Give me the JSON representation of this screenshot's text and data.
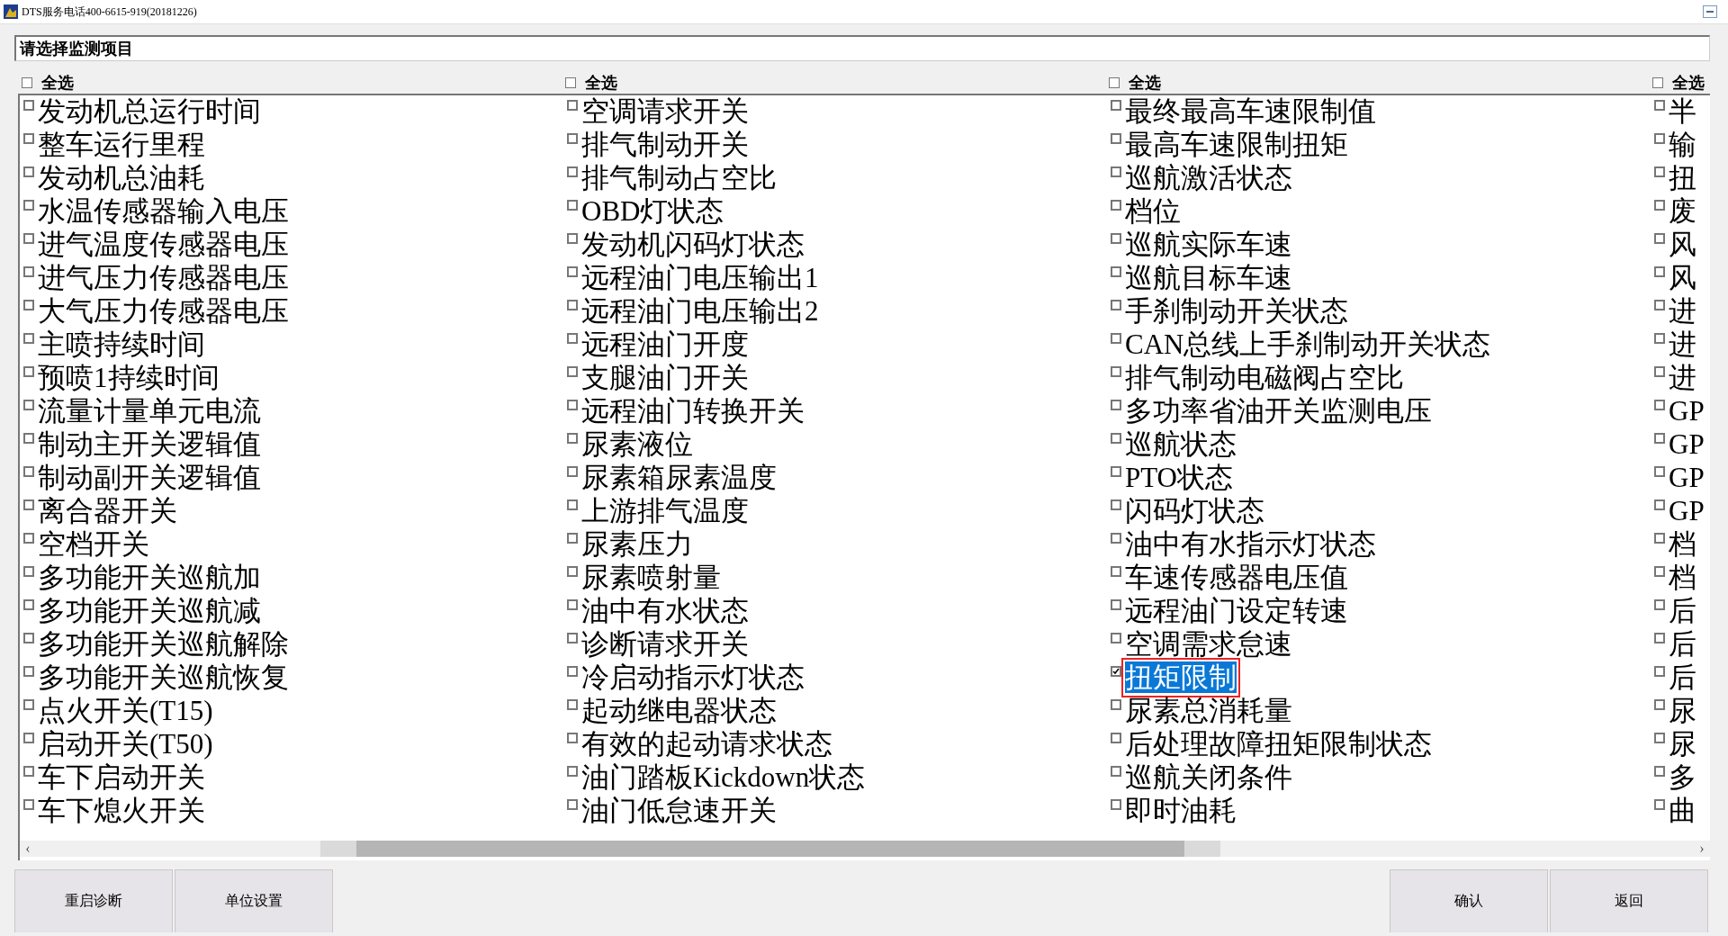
{
  "window": {
    "title": "DTS服务电话400-6615-919(20181226)"
  },
  "prompt": "请选择监测项目",
  "columns": [
    {
      "select_all": {
        "label": "全选",
        "checked": false
      },
      "items": [
        {
          "label": "发动机总运行时间",
          "checked": false,
          "selected": false
        },
        {
          "label": "整车运行里程",
          "checked": false,
          "selected": false
        },
        {
          "label": "发动机总油耗",
          "checked": false,
          "selected": false
        },
        {
          "label": "水温传感器输入电压",
          "checked": false,
          "selected": false
        },
        {
          "label": "进气温度传感器电压",
          "checked": false,
          "selected": false
        },
        {
          "label": "进气压力传感器电压",
          "checked": false,
          "selected": false
        },
        {
          "label": "大气压力传感器电压",
          "checked": false,
          "selected": false
        },
        {
          "label": "主喷持续时间",
          "checked": false,
          "selected": false
        },
        {
          "label": "预喷1持续时间",
          "checked": false,
          "selected": false
        },
        {
          "label": "流量计量单元电流",
          "checked": false,
          "selected": false
        },
        {
          "label": "制动主开关逻辑值",
          "checked": false,
          "selected": false
        },
        {
          "label": "制动副开关逻辑值",
          "checked": false,
          "selected": false
        },
        {
          "label": "离合器开关",
          "checked": false,
          "selected": false
        },
        {
          "label": "空档开关",
          "checked": false,
          "selected": false
        },
        {
          "label": "多功能开关巡航加",
          "checked": false,
          "selected": false
        },
        {
          "label": "多功能开关巡航减",
          "checked": false,
          "selected": false
        },
        {
          "label": "多功能开关巡航解除",
          "checked": false,
          "selected": false
        },
        {
          "label": "多功能开关巡航恢复",
          "checked": false,
          "selected": false
        },
        {
          "label": "点火开关(T15)",
          "checked": false,
          "selected": false
        },
        {
          "label": "启动开关(T50)",
          "checked": false,
          "selected": false
        },
        {
          "label": "车下启动开关",
          "checked": false,
          "selected": false
        },
        {
          "label": "车下熄火开关",
          "checked": false,
          "selected": false
        }
      ]
    },
    {
      "select_all": {
        "label": "全选",
        "checked": false
      },
      "items": [
        {
          "label": "空调请求开关",
          "checked": false,
          "selected": false
        },
        {
          "label": "排气制动开关",
          "checked": false,
          "selected": false
        },
        {
          "label": "排气制动占空比",
          "checked": false,
          "selected": false
        },
        {
          "label": "OBD灯状态",
          "checked": false,
          "selected": false
        },
        {
          "label": "发动机闪码灯状态",
          "checked": false,
          "selected": false
        },
        {
          "label": "远程油门电压输出1",
          "checked": false,
          "selected": false
        },
        {
          "label": "远程油门电压输出2",
          "checked": false,
          "selected": false
        },
        {
          "label": "远程油门开度",
          "checked": false,
          "selected": false
        },
        {
          "label": "支腿油门开关",
          "checked": false,
          "selected": false
        },
        {
          "label": "远程油门转换开关",
          "checked": false,
          "selected": false
        },
        {
          "label": "尿素液位",
          "checked": false,
          "selected": false
        },
        {
          "label": "尿素箱尿素温度",
          "checked": false,
          "selected": false
        },
        {
          "label": "上游排气温度",
          "checked": false,
          "selected": false
        },
        {
          "label": "尿素压力",
          "checked": false,
          "selected": false
        },
        {
          "label": "尿素喷射量",
          "checked": false,
          "selected": false
        },
        {
          "label": "油中有水状态",
          "checked": false,
          "selected": false
        },
        {
          "label": "诊断请求开关",
          "checked": false,
          "selected": false
        },
        {
          "label": "冷启动指示灯状态",
          "checked": false,
          "selected": false
        },
        {
          "label": "起动继电器状态",
          "checked": false,
          "selected": false
        },
        {
          "label": "有效的起动请求状态",
          "checked": false,
          "selected": false
        },
        {
          "label": "油门踏板Kickdown状态",
          "checked": false,
          "selected": false
        },
        {
          "label": "油门低怠速开关",
          "checked": false,
          "selected": false
        }
      ]
    },
    {
      "select_all": {
        "label": "全选",
        "checked": false
      },
      "items": [
        {
          "label": "最终最高车速限制值",
          "checked": false,
          "selected": false
        },
        {
          "label": "最高车速限制扭矩",
          "checked": false,
          "selected": false
        },
        {
          "label": "巡航激活状态",
          "checked": false,
          "selected": false
        },
        {
          "label": "档位",
          "checked": false,
          "selected": false
        },
        {
          "label": "巡航实际车速",
          "checked": false,
          "selected": false
        },
        {
          "label": "巡航目标车速",
          "checked": false,
          "selected": false
        },
        {
          "label": "手刹制动开关状态",
          "checked": false,
          "selected": false
        },
        {
          "label": "CAN总线上手刹制动开关状态",
          "checked": false,
          "selected": false
        },
        {
          "label": "排气制动电磁阀占空比",
          "checked": false,
          "selected": false
        },
        {
          "label": "多功率省油开关监测电压",
          "checked": false,
          "selected": false
        },
        {
          "label": "巡航状态",
          "checked": false,
          "selected": false
        },
        {
          "label": "PTO状态",
          "checked": false,
          "selected": false
        },
        {
          "label": "闪码灯状态",
          "checked": false,
          "selected": false
        },
        {
          "label": "油中有水指示灯状态",
          "checked": false,
          "selected": false
        },
        {
          "label": "车速传感器电压值",
          "checked": false,
          "selected": false
        },
        {
          "label": "远程油门设定转速",
          "checked": false,
          "selected": false
        },
        {
          "label": "空调需求怠速",
          "checked": false,
          "selected": false
        },
        {
          "label": "扭矩限制",
          "checked": true,
          "selected": true
        },
        {
          "label": "尿素总消耗量",
          "checked": false,
          "selected": false
        },
        {
          "label": "后处理故障扭矩限制状态",
          "checked": false,
          "selected": false
        },
        {
          "label": "巡航关闭条件",
          "checked": false,
          "selected": false
        },
        {
          "label": "即时油耗",
          "checked": false,
          "selected": false
        }
      ]
    },
    {
      "select_all": {
        "label": "全选",
        "checked": false
      },
      "items": [
        {
          "label": "半",
          "checked": false,
          "selected": false
        },
        {
          "label": "输",
          "checked": false,
          "selected": false
        },
        {
          "label": "扭",
          "checked": false,
          "selected": false
        },
        {
          "label": "废",
          "checked": false,
          "selected": false
        },
        {
          "label": "风",
          "checked": false,
          "selected": false
        },
        {
          "label": "风",
          "checked": false,
          "selected": false
        },
        {
          "label": "进",
          "checked": false,
          "selected": false
        },
        {
          "label": "进",
          "checked": false,
          "selected": false
        },
        {
          "label": "进",
          "checked": false,
          "selected": false
        },
        {
          "label": "GP",
          "checked": false,
          "selected": false
        },
        {
          "label": "GP",
          "checked": false,
          "selected": false
        },
        {
          "label": "GP",
          "checked": false,
          "selected": false
        },
        {
          "label": "GP",
          "checked": false,
          "selected": false
        },
        {
          "label": "档",
          "checked": false,
          "selected": false
        },
        {
          "label": "档",
          "checked": false,
          "selected": false
        },
        {
          "label": "后",
          "checked": false,
          "selected": false
        },
        {
          "label": "后",
          "checked": false,
          "selected": false
        },
        {
          "label": "后",
          "checked": false,
          "selected": false
        },
        {
          "label": "尿",
          "checked": false,
          "selected": false
        },
        {
          "label": "尿",
          "checked": false,
          "selected": false
        },
        {
          "label": "多",
          "checked": false,
          "selected": false
        },
        {
          "label": "曲",
          "checked": false,
          "selected": false
        }
      ]
    }
  ],
  "scrollbar": {
    "left_arrow": "‹",
    "right_arrow": "›"
  },
  "buttons_left": [
    "重启诊断",
    "单位设置"
  ],
  "buttons_right": [
    "确认",
    "返回"
  ]
}
